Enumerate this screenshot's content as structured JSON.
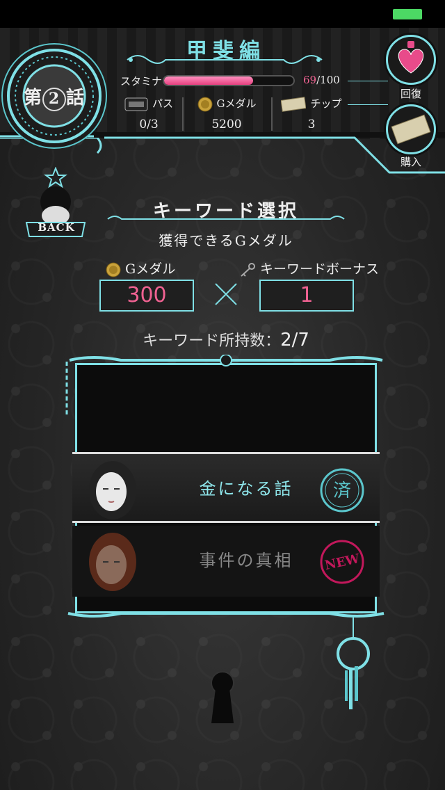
{
  "status_bar": {
    "battery_color": "#4cd964"
  },
  "header": {
    "episode_prefix": "第",
    "episode_number": "2",
    "episode_suffix": "話",
    "title": "甲斐編",
    "stamina_label": "スタミナ",
    "stamina_current": "69",
    "stamina_max": "/100",
    "stamina_fraction": 0.69,
    "stats": [
      {
        "icon": "pass-ticket-icon",
        "label": "パス",
        "value": "0/3"
      },
      {
        "icon": "g-medal-icon",
        "label": "Gメダル",
        "value": "5200"
      },
      {
        "icon": "tip-ticket-icon",
        "label": "チップ",
        "value": "3"
      }
    ],
    "recover_label": "回復",
    "buy_label": "購入"
  },
  "back": {
    "label": "BACK"
  },
  "main": {
    "section_title": "キーワード選択",
    "sub_caption": "獲得できるGメダル",
    "medal_label": "Gメダル",
    "bonus_label": "キーワードボーナス",
    "medal_value": "300",
    "bonus_value": "1",
    "count_label": "キーワード所持数：",
    "count_value": "2/7"
  },
  "keywords": [
    {
      "text": "金になる話",
      "stamp": "済",
      "state": "selected"
    },
    {
      "text": "事件の真相",
      "stamp": "NEW",
      "state": "new"
    }
  ],
  "colors": {
    "accent": "#7fe0e6",
    "pink": "#f06292",
    "stamp_blue": "#5bc6cc",
    "stamp_pink": "#c2185b"
  }
}
